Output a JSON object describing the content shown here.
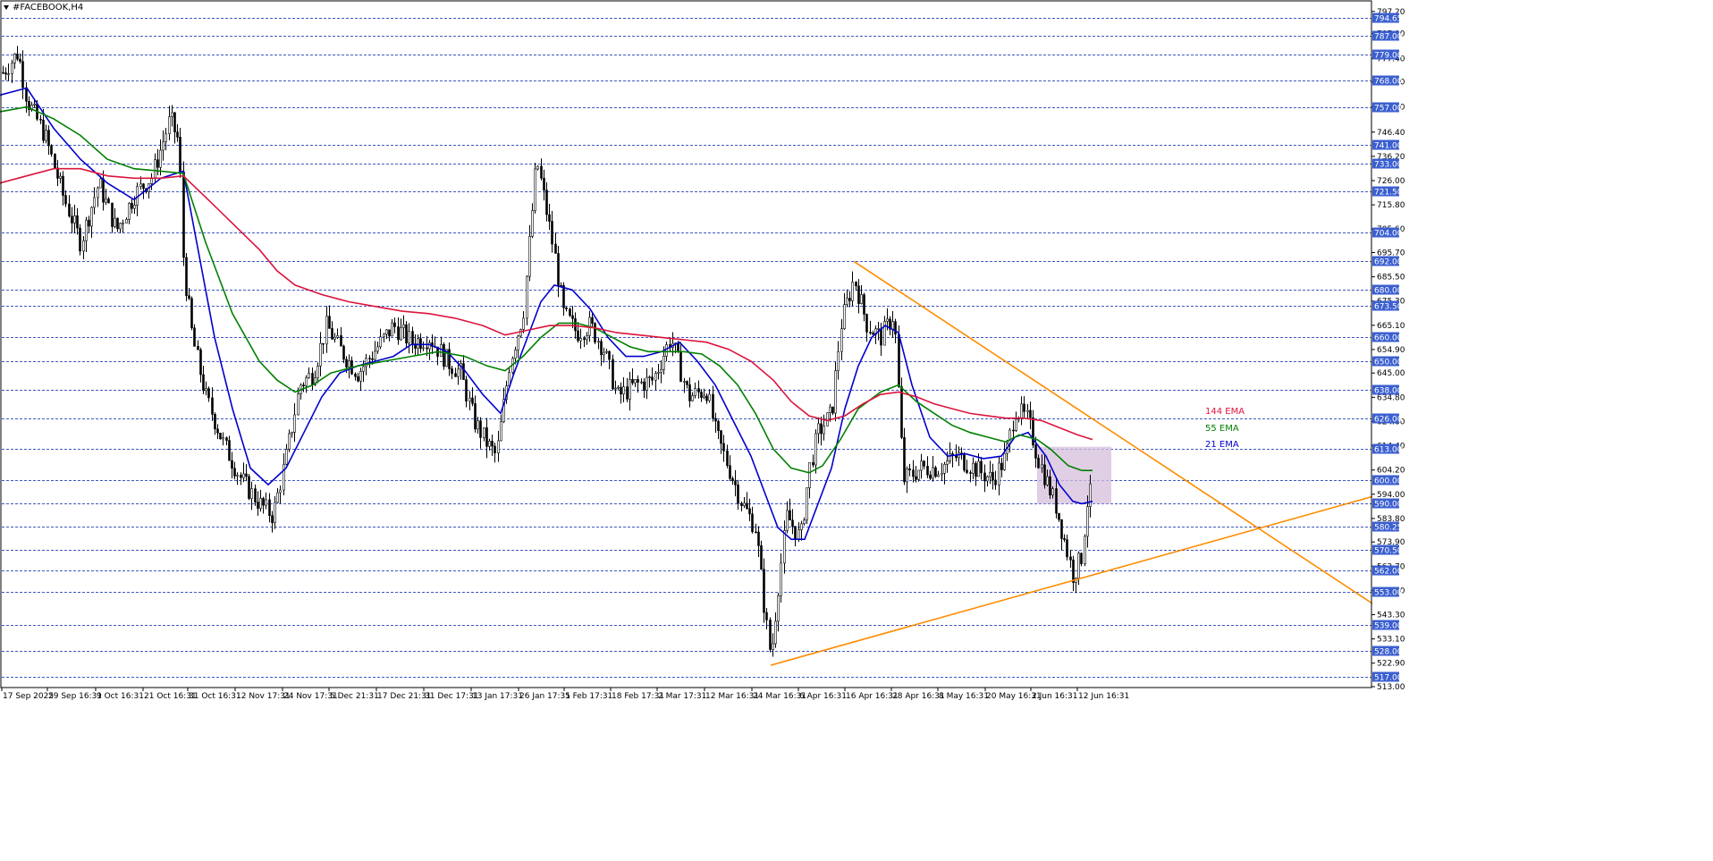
{
  "window": {
    "title": "#FACEBOOK,H4",
    "menu_icon": "triangle-down-icon"
  },
  "colors": {
    "candle": "#000000",
    "ema21": "#0000cd",
    "ema55": "#008000",
    "ema144": "#dc143c",
    "trendline": "#ff8c00",
    "grid": "#1e3cb4",
    "level_bg": "#3b5fd0",
    "zone": "#d6bedc"
  },
  "chart_data": {
    "type": "candlestick",
    "symbol": "#FACEBOOK",
    "timeframe": "H4",
    "grid": true,
    "ylim": [
      513,
      800
    ],
    "y_ticks": [
      "797.20",
      "787.90",
      "777.40",
      "767.50",
      "757.00",
      "746.40",
      "736.20",
      "726.00",
      "715.80",
      "705.60",
      "695.70",
      "685.50",
      "675.30",
      "665.10",
      "654.90",
      "645.00",
      "634.80",
      "624.60",
      "614.40",
      "604.20",
      "594.00",
      "583.80",
      "573.90",
      "563.70",
      "553.50",
      "543.30",
      "533.10",
      "522.90",
      "513.00"
    ],
    "levels": [
      "794.65",
      "787.00",
      "779.00",
      "768.00",
      "757.00",
      "741.00",
      "733.00",
      "721.50",
      "704.00",
      "692.00",
      "680.00",
      "673.50",
      "660.00",
      "650.00",
      "638.00",
      "626.00",
      "613.00",
      "600.00",
      "590.00",
      "580.25",
      "570.50",
      "562.00",
      "553.00",
      "539.00",
      "528.00",
      "517.00"
    ],
    "x_labels": [
      "17 Sep 2025",
      "29 Sep 16:31",
      "9 Oct 16:31",
      "21 Oct 16:31",
      "31 Oct 16:31",
      "12 Nov 17:31",
      "24 Nov 17:31",
      "5 Dec 21:31",
      "17 Dec 21:31",
      "31 Dec 17:31",
      "13 Jan 17:31",
      "26 Jan 17:31",
      "5 Feb 17:31",
      "18 Feb 17:31",
      "2 Mar 17:31",
      "12 Mar 16:31",
      "24 Mar 16:31",
      "6 Apr 16:31",
      "16 Apr 16:31",
      "28 Apr 16:31",
      "8 May 16:31",
      "20 May 16:31",
      "2 Jun 16:31",
      "12 Jun 16:31"
    ],
    "price_path": [
      [
        0,
        770
      ],
      [
        20,
        780
      ],
      [
        30,
        760
      ],
      [
        50,
        745
      ],
      [
        70,
        720
      ],
      [
        90,
        700
      ],
      [
        110,
        725
      ],
      [
        130,
        705
      ],
      [
        150,
        720
      ],
      [
        170,
        728
      ],
      [
        190,
        752
      ],
      [
        200,
        742
      ],
      [
        205,
        690
      ],
      [
        215,
        660
      ],
      [
        230,
        635
      ],
      [
        250,
        615
      ],
      [
        270,
        600
      ],
      [
        290,
        590
      ],
      [
        305,
        585
      ],
      [
        320,
        610
      ],
      [
        335,
        640
      ],
      [
        350,
        645
      ],
      [
        365,
        665
      ],
      [
        380,
        655
      ],
      [
        400,
        645
      ],
      [
        420,
        655
      ],
      [
        440,
        665
      ],
      [
        460,
        658
      ],
      [
        480,
        660
      ],
      [
        500,
        650
      ],
      [
        515,
        645
      ],
      [
        530,
        625
      ],
      [
        545,
        615
      ],
      [
        555,
        610
      ],
      [
        570,
        650
      ],
      [
        585,
        670
      ],
      [
        600,
        735
      ],
      [
        610,
        715
      ],
      [
        620,
        695
      ],
      [
        630,
        670
      ],
      [
        645,
        662
      ],
      [
        660,
        665
      ],
      [
        675,
        655
      ],
      [
        690,
        635
      ],
      [
        710,
        640
      ],
      [
        730,
        642
      ],
      [
        750,
        660
      ],
      [
        770,
        635
      ],
      [
        790,
        638
      ],
      [
        800,
        620
      ],
      [
        815,
        605
      ],
      [
        830,
        590
      ],
      [
        845,
        580
      ],
      [
        855,
        545
      ],
      [
        862,
        525
      ],
      [
        870,
        555
      ],
      [
        880,
        585
      ],
      [
        895,
        575
      ],
      [
        905,
        605
      ],
      [
        915,
        620
      ],
      [
        930,
        628
      ],
      [
        940,
        665
      ],
      [
        955,
        685
      ],
      [
        970,
        665
      ],
      [
        985,
        660
      ],
      [
        1000,
        670
      ],
      [
        1010,
        600
      ],
      [
        1030,
        605
      ],
      [
        1050,
        605
      ],
      [
        1070,
        610
      ],
      [
        1090,
        605
      ],
      [
        1110,
        600
      ],
      [
        1125,
        610
      ],
      [
        1135,
        630
      ],
      [
        1150,
        625
      ],
      [
        1160,
        610
      ],
      [
        1170,
        600
      ],
      [
        1180,
        590
      ],
      [
        1190,
        575
      ],
      [
        1200,
        560
      ],
      [
        1210,
        568
      ],
      [
        1215,
        590
      ],
      [
        1225,
        600
      ]
    ],
    "series": [
      {
        "name": "21 EMA",
        "values": [
          [
            0,
            762
          ],
          [
            30,
            765
          ],
          [
            60,
            748
          ],
          [
            90,
            735
          ],
          [
            120,
            725
          ],
          [
            150,
            718
          ],
          [
            180,
            727
          ],
          [
            205,
            730
          ],
          [
            220,
            700
          ],
          [
            240,
            660
          ],
          [
            260,
            630
          ],
          [
            280,
            605
          ],
          [
            300,
            598
          ],
          [
            320,
            605
          ],
          [
            340,
            620
          ],
          [
            360,
            635
          ],
          [
            380,
            645
          ],
          [
            400,
            648
          ],
          [
            420,
            650
          ],
          [
            440,
            652
          ],
          [
            460,
            657
          ],
          [
            480,
            657
          ],
          [
            500,
            654
          ],
          [
            520,
            646
          ],
          [
            540,
            636
          ],
          [
            560,
            628
          ],
          [
            575,
            645
          ],
          [
            590,
            660
          ],
          [
            605,
            675
          ],
          [
            620,
            682
          ],
          [
            640,
            680
          ],
          [
            660,
            672
          ],
          [
            680,
            660
          ],
          [
            700,
            652
          ],
          [
            720,
            652
          ],
          [
            740,
            654
          ],
          [
            760,
            658
          ],
          [
            780,
            650
          ],
          [
            800,
            640
          ],
          [
            820,
            625
          ],
          [
            840,
            610
          ],
          [
            855,
            595
          ],
          [
            870,
            580
          ],
          [
            885,
            575
          ],
          [
            900,
            575
          ],
          [
            915,
            590
          ],
          [
            930,
            605
          ],
          [
            945,
            630
          ],
          [
            960,
            648
          ],
          [
            975,
            660
          ],
          [
            990,
            665
          ],
          [
            1005,
            662
          ],
          [
            1020,
            640
          ],
          [
            1040,
            618
          ],
          [
            1060,
            610
          ],
          [
            1080,
            611
          ],
          [
            1100,
            609
          ],
          [
            1120,
            610
          ],
          [
            1135,
            618
          ],
          [
            1150,
            620
          ],
          [
            1160,
            615
          ],
          [
            1170,
            610
          ],
          [
            1185,
            598
          ],
          [
            1200,
            591
          ],
          [
            1210,
            590
          ],
          [
            1222,
            591
          ]
        ]
      },
      {
        "name": "55 EMA",
        "values": [
          [
            0,
            755
          ],
          [
            30,
            757
          ],
          [
            60,
            752
          ],
          [
            90,
            745
          ],
          [
            120,
            735
          ],
          [
            150,
            731
          ],
          [
            180,
            730
          ],
          [
            205,
            729
          ],
          [
            230,
            700
          ],
          [
            260,
            670
          ],
          [
            290,
            650
          ],
          [
            310,
            642
          ],
          [
            330,
            637
          ],
          [
            350,
            640
          ],
          [
            370,
            645
          ],
          [
            400,
            648
          ],
          [
            430,
            650
          ],
          [
            460,
            652
          ],
          [
            490,
            654
          ],
          [
            520,
            652
          ],
          [
            545,
            648
          ],
          [
            565,
            646
          ],
          [
            585,
            652
          ],
          [
            605,
            660
          ],
          [
            625,
            666
          ],
          [
            645,
            666
          ],
          [
            665,
            664
          ],
          [
            685,
            660
          ],
          [
            705,
            656
          ],
          [
            725,
            654
          ],
          [
            745,
            654
          ],
          [
            765,
            654
          ],
          [
            785,
            653
          ],
          [
            805,
            648
          ],
          [
            825,
            640
          ],
          [
            845,
            628
          ],
          [
            865,
            613
          ],
          [
            885,
            605
          ],
          [
            905,
            603
          ],
          [
            920,
            606
          ],
          [
            940,
            617
          ],
          [
            960,
            630
          ],
          [
            985,
            637
          ],
          [
            1005,
            640
          ],
          [
            1025,
            633
          ],
          [
            1045,
            628
          ],
          [
            1065,
            623
          ],
          [
            1085,
            620
          ],
          [
            1105,
            618
          ],
          [
            1125,
            616
          ],
          [
            1140,
            619
          ],
          [
            1160,
            617
          ],
          [
            1175,
            613
          ],
          [
            1195,
            606
          ],
          [
            1210,
            604
          ],
          [
            1222,
            604
          ]
        ]
      },
      {
        "name": "144 EMA",
        "values": [
          [
            0,
            725
          ],
          [
            30,
            728
          ],
          [
            60,
            731
          ],
          [
            90,
            731
          ],
          [
            120,
            728
          ],
          [
            150,
            727
          ],
          [
            180,
            727
          ],
          [
            205,
            728
          ],
          [
            230,
            719
          ],
          [
            260,
            708
          ],
          [
            290,
            697
          ],
          [
            310,
            688
          ],
          [
            330,
            682
          ],
          [
            360,
            678
          ],
          [
            390,
            675
          ],
          [
            420,
            673
          ],
          [
            450,
            671
          ],
          [
            480,
            670
          ],
          [
            510,
            668
          ],
          [
            540,
            665
          ],
          [
            565,
            661
          ],
          [
            590,
            663
          ],
          [
            615,
            665
          ],
          [
            640,
            665
          ],
          [
            665,
            664
          ],
          [
            690,
            662
          ],
          [
            715,
            661
          ],
          [
            740,
            660
          ],
          [
            765,
            659
          ],
          [
            790,
            658
          ],
          [
            815,
            655
          ],
          [
            840,
            650
          ],
          [
            865,
            642
          ],
          [
            885,
            633
          ],
          [
            905,
            627
          ],
          [
            925,
            625
          ],
          [
            945,
            627
          ],
          [
            965,
            632
          ],
          [
            985,
            636
          ],
          [
            1005,
            637
          ],
          [
            1025,
            635
          ],
          [
            1045,
            632
          ],
          [
            1065,
            630
          ],
          [
            1085,
            628
          ],
          [
            1105,
            627
          ],
          [
            1125,
            626
          ],
          [
            1145,
            626
          ],
          [
            1165,
            625
          ],
          [
            1185,
            622
          ],
          [
            1205,
            619
          ],
          [
            1222,
            617
          ]
        ]
      }
    ],
    "trendlines": [
      {
        "from": [
          955,
          692
        ],
        "to": [
          1535,
          548
        ]
      },
      {
        "from": [
          862,
          522
        ],
        "to": [
          1535,
          593
        ]
      }
    ],
    "zone": {
      "x0": 1160,
      "x1": 1243,
      "y0": 590,
      "y1": 614
    },
    "series_labels": [
      "144 EMA",
      "55 EMA",
      "21 EMA"
    ]
  }
}
